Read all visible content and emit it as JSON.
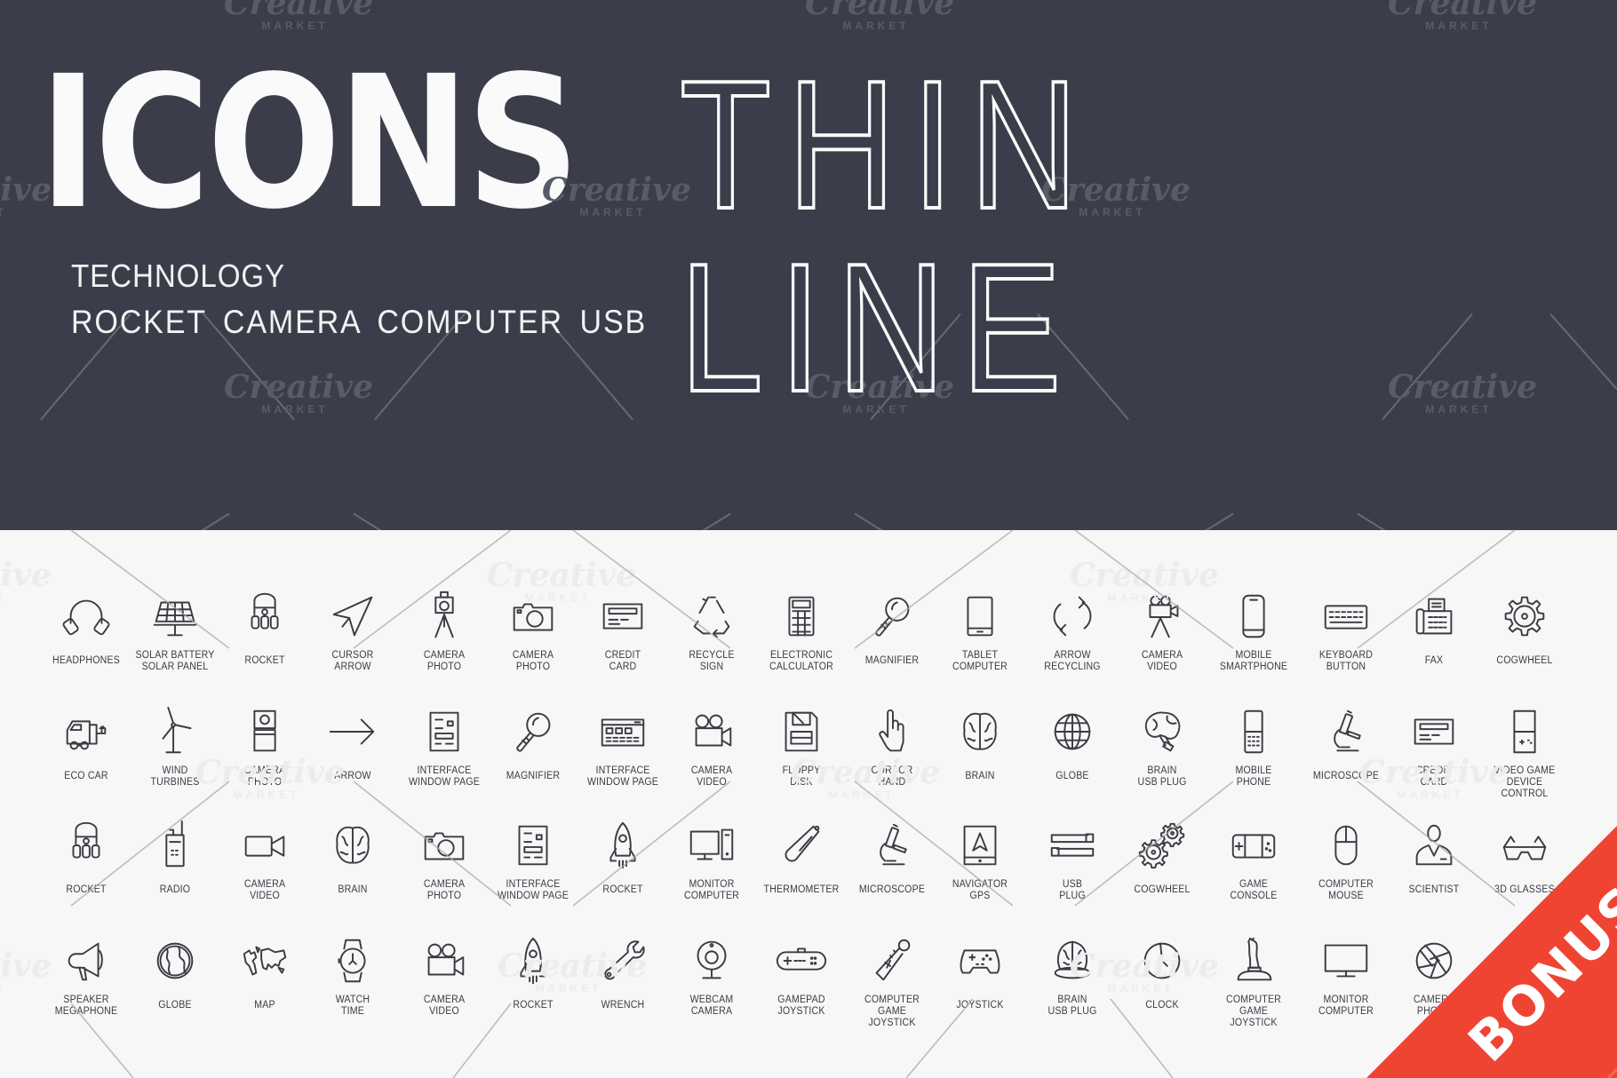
{
  "header": {
    "title_bold": "ICONS",
    "title_thin": "THIN LINE",
    "subtitle": "TECHNOLOGY",
    "keywords": "ROCKET CAMERA COMPUTER USB"
  },
  "watermark": {
    "brand": "Creative",
    "sub": "MARKET"
  },
  "badge": {
    "label": "BONUS",
    "color": "#f04433"
  },
  "colors": {
    "hero_bg": "#3b3e4a",
    "grid_bg": "#f7f7f7",
    "icon_stroke": "#3a3c44"
  },
  "icon_rows": [
    [
      {
        "icon": "headphones-icon",
        "label": "HEADPHONES"
      },
      {
        "icon": "solar-panel-icon",
        "label": "SOLAR BATTERY\nSOLAR PANEL"
      },
      {
        "icon": "rocket-icon",
        "label": "ROCKET"
      },
      {
        "icon": "cursor-arrow-icon",
        "label": "CURSOR\nARROW"
      },
      {
        "icon": "camera-tripod-icon",
        "label": "CAMERA\nPHOTO"
      },
      {
        "icon": "camera-photo-icon",
        "label": "CAMERA\nPHOTO"
      },
      {
        "icon": "credit-card-icon",
        "label": "CREDIT\nCARD"
      },
      {
        "icon": "recycle-icon",
        "label": "RECYCLE\nSIGN"
      },
      {
        "icon": "calculator-icon",
        "label": "ELECTRONIC\nCALCULATOR"
      },
      {
        "icon": "magnifier-icon",
        "label": "MAGNIFIER"
      },
      {
        "icon": "tablet-icon",
        "label": "TABLET\nCOMPUTER"
      },
      {
        "icon": "arrow-recycling-icon",
        "label": "ARROW\nRECYCLING"
      },
      {
        "icon": "camera-video-tripod-icon",
        "label": "CAMERA\nVIDEO"
      },
      {
        "icon": "smartphone-icon",
        "label": "MOBILE\nSMARTPHONE"
      },
      {
        "icon": "keyboard-icon",
        "label": "KEYBOARD\nBUTTON"
      },
      {
        "icon": "fax-icon",
        "label": "FAX"
      },
      {
        "icon": "cogwheel-icon",
        "label": "COGWHEEL"
      }
    ],
    [
      {
        "icon": "eco-car-icon",
        "label": "ECO CAR"
      },
      {
        "icon": "wind-turbine-icon",
        "label": "WIND\nTURBINES"
      },
      {
        "icon": "instant-camera-icon",
        "label": "CAMERA\nPHOTO"
      },
      {
        "icon": "arrow-right-icon",
        "label": "ARROW"
      },
      {
        "icon": "window-page-icon",
        "label": "INTERFACE\nWINDOW PAGE"
      },
      {
        "icon": "magnifier-icon",
        "label": "MAGNIFIER"
      },
      {
        "icon": "browser-window-icon",
        "label": "INTERFACE\nWINDOW PAGE"
      },
      {
        "icon": "movie-camera-icon",
        "label": "CAMERA\nVIDEO"
      },
      {
        "icon": "floppy-disk-icon",
        "label": "FLOPPY\nDISK"
      },
      {
        "icon": "cursor-hand-icon",
        "label": "CURSOR\nHAND"
      },
      {
        "icon": "brain-icon",
        "label": "BRAIN"
      },
      {
        "icon": "globe-icon",
        "label": "GLOBE"
      },
      {
        "icon": "brain-usb-icon",
        "label": "BRAIN\nUSB PLUG"
      },
      {
        "icon": "mobile-phone-icon",
        "label": "MOBILE\nPHONE"
      },
      {
        "icon": "microscope-icon",
        "label": "MICROSCOPE"
      },
      {
        "icon": "credit-card-icon",
        "label": "CREDIT\nCARD"
      },
      {
        "icon": "handheld-game-icon",
        "label": "VIDEO GAME\nDEVICE CONTROL"
      }
    ],
    [
      {
        "icon": "rocket-icon",
        "label": "ROCKET"
      },
      {
        "icon": "radio-icon",
        "label": "RADIO"
      },
      {
        "icon": "video-camera-icon",
        "label": "CAMERA\nVIDEO"
      },
      {
        "icon": "brain-icon",
        "label": "BRAIN"
      },
      {
        "icon": "camera-photo-icon",
        "label": "CAMERA\nPHOTO"
      },
      {
        "icon": "window-page-icon",
        "label": "INTERFACE\nWINDOW PAGE"
      },
      {
        "icon": "rocket-ship-icon",
        "label": "ROCKET"
      },
      {
        "icon": "monitor-computer-icon",
        "label": "MONITOR\nCOMPUTER"
      },
      {
        "icon": "thermometer-icon",
        "label": "THERMOMETER"
      },
      {
        "icon": "microscope-icon",
        "label": "MICROSCOPE"
      },
      {
        "icon": "gps-navigator-icon",
        "label": "NAVIGATOR\nGPS"
      },
      {
        "icon": "usb-plug-icon",
        "label": "USB\nPLUG"
      },
      {
        "icon": "cogwheels-icon",
        "label": "COGWHEEL"
      },
      {
        "icon": "game-console-icon",
        "label": "GAME\nCONSOLE"
      },
      {
        "icon": "computer-mouse-icon",
        "label": "COMPUTER\nMOUSE"
      },
      {
        "icon": "scientist-icon",
        "label": "SCIENTIST"
      },
      {
        "icon": "3d-glasses-icon",
        "label": "3D GLASSES"
      }
    ],
    [
      {
        "icon": "megaphone-icon",
        "label": "SPEAKER\nMEGAPHONE"
      },
      {
        "icon": "globe-earth-icon",
        "label": "GLOBE"
      },
      {
        "icon": "world-map-icon",
        "label": "MAP"
      },
      {
        "icon": "wristwatch-icon",
        "label": "WATCH\nTIME"
      },
      {
        "icon": "movie-camera-icon",
        "label": "CAMERA\nVIDEO"
      },
      {
        "icon": "rocket-ship-icon",
        "label": "ROCKET"
      },
      {
        "icon": "wrench-icon",
        "label": "WRENCH"
      },
      {
        "icon": "webcam-icon",
        "label": "WEBCAM\nCAMERA"
      },
      {
        "icon": "gamepad-icon",
        "label": "GAMEPAD\nJOYSTICK"
      },
      {
        "icon": "motion-controller-icon",
        "label": "COMPUTER GAME\nJOYSTICK"
      },
      {
        "icon": "joystick-icon",
        "label": "JOYSTICK"
      },
      {
        "icon": "brain-dome-icon",
        "label": "BRAIN\nUSB PLUG"
      },
      {
        "icon": "clock-icon",
        "label": "CLOCK"
      },
      {
        "icon": "flight-stick-icon",
        "label": "COMPUTER GAME\nJOYSTICK"
      },
      {
        "icon": "monitor-icon",
        "label": "MONITOR\nCOMPUTER"
      },
      {
        "icon": "camera-aperture-icon",
        "label": "CAMERA\nPHOTO"
      }
    ]
  ]
}
